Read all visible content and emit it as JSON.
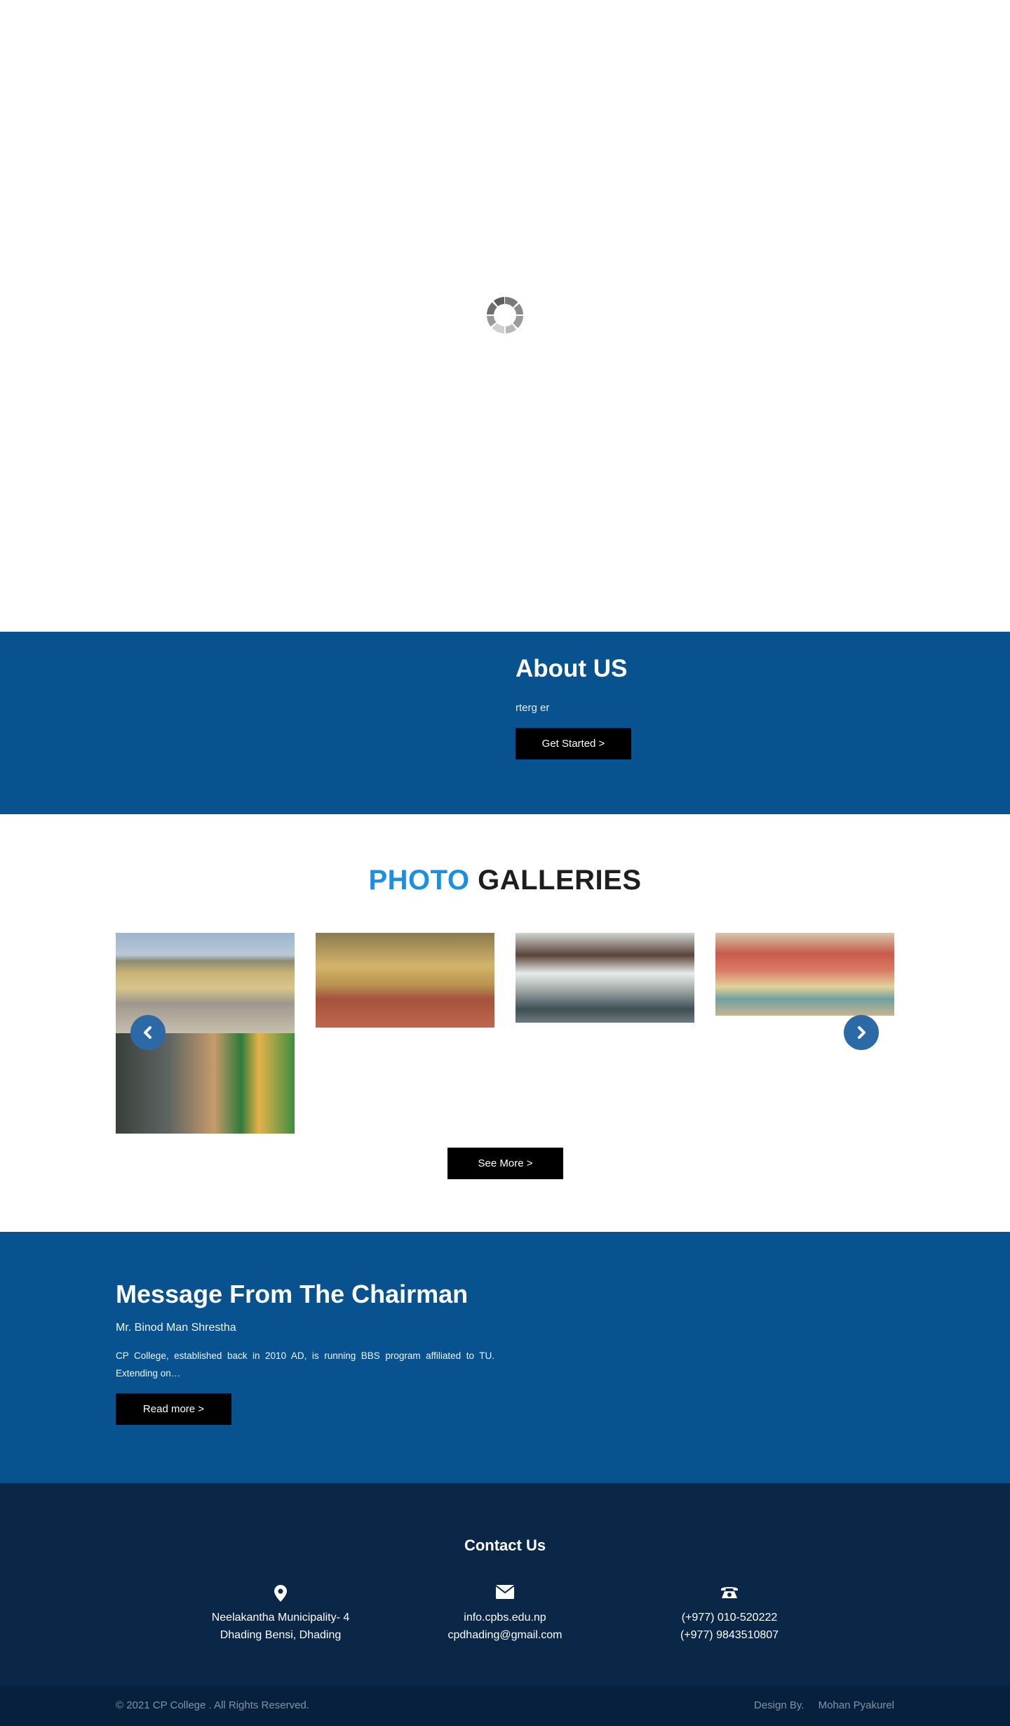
{
  "about": {
    "title": "About US",
    "text": "rterg er",
    "button": "Get Started >"
  },
  "gallery": {
    "title_highlight": "PHOTO",
    "title_rest": "GALLERIES",
    "prev_icon": "chevron-left-icon",
    "next_icon": "chevron-right-icon",
    "button": "See More >"
  },
  "chairman": {
    "title": "Message From The Chairman",
    "name": "Mr. Binod Man Shrestha",
    "text": "CP College, established back in 2010 AD, is running BBS program affiliated to TU. Extending on…",
    "button": "Read more >"
  },
  "contact": {
    "title": "Contact Us",
    "address": [
      "Neelakantha Municipality- 4",
      "Dhading Bensi, Dhading"
    ],
    "emails": [
      "info.cpbs.edu.np",
      "cpdhading@gmail.com"
    ],
    "phones": [
      "(+977) 010-520222",
      "(+977) 9843510807"
    ],
    "icons": [
      "map-marker-icon",
      "envelope-icon",
      "phone-icon"
    ]
  },
  "footer": {
    "copyright": "© 2021 CP College . All Rights Reserved.",
    "design_label": "Design By.",
    "designer": "Mohan Pyakurel"
  },
  "colors": {
    "primary_blue": "#08528f",
    "dark_navy": "#0a2748",
    "accent_blue": "#1a8fe3"
  }
}
